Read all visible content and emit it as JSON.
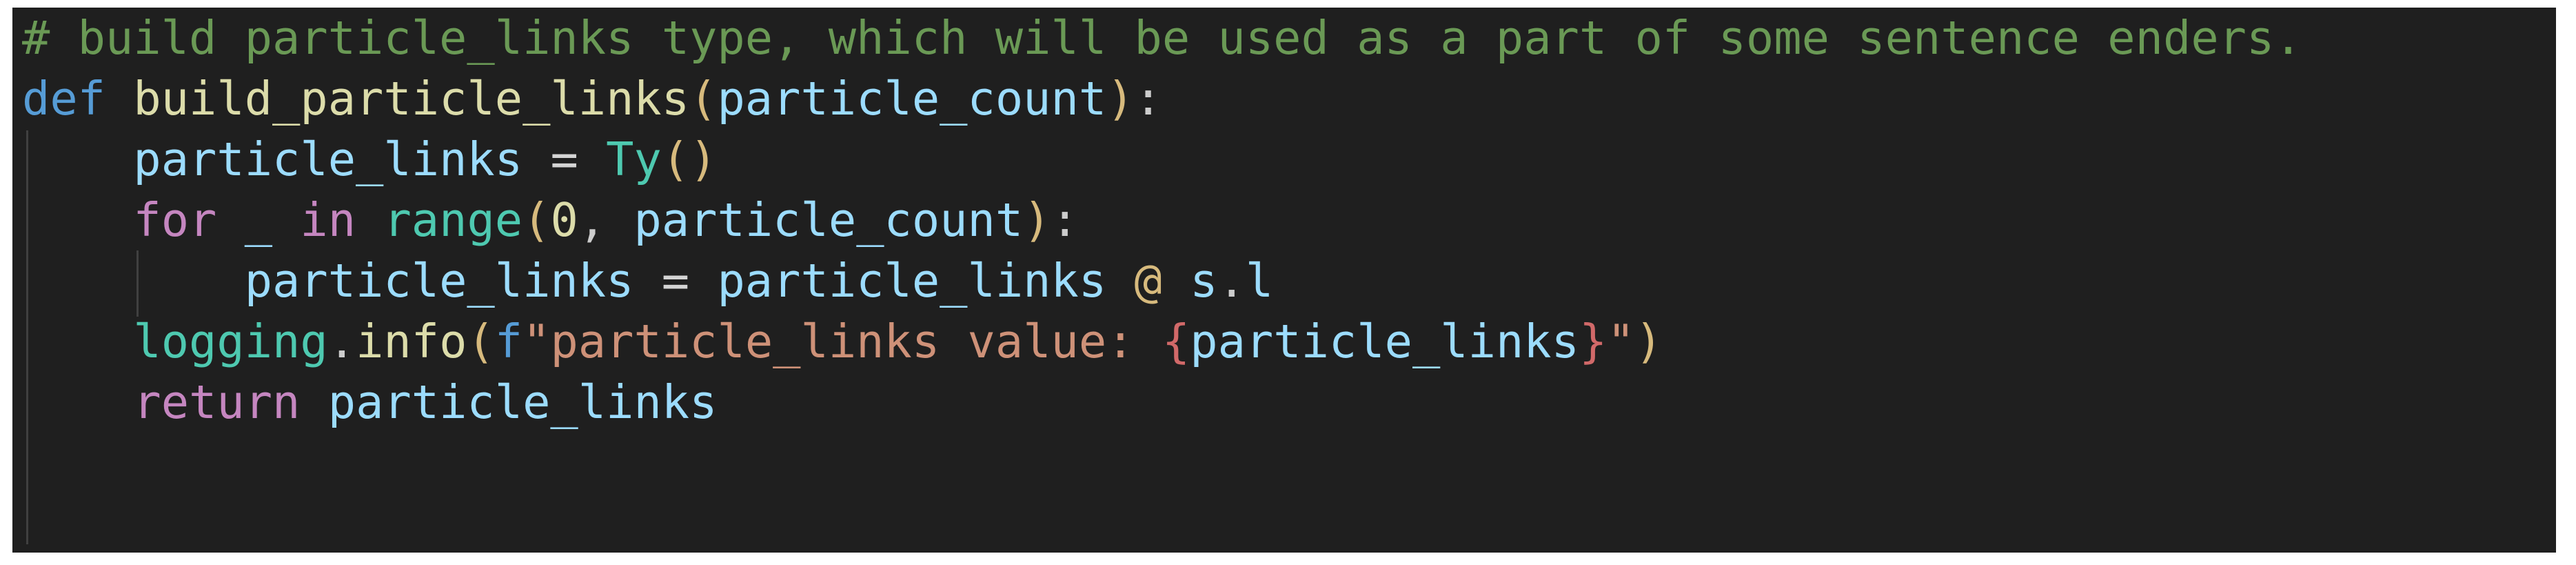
{
  "editor": {
    "background_color": "#1f1f1f",
    "page_background_color": "#ffffff",
    "language": "python",
    "indent_guide_color": "#404040",
    "palette": {
      "comment": "#6A9955",
      "keyword": "#569CD6",
      "control_keyword": "#C586C0",
      "function_name": "#DCDCAA",
      "class_name": "#4EC9B0",
      "builtin": "#4EC9B0",
      "variable": "#9CDCFE",
      "parameter": "#9CDCFE",
      "bracket_level_1": "#D7BA7D",
      "bracket_level_2": "#FFD700",
      "operator": "#D4D4D4",
      "number": "#DCDCAA",
      "string": "#CE9178",
      "fstring_brace": "#D16969"
    }
  },
  "code": {
    "plain_text": "# build particle_links type, which will be used as a part of some sentence enders.\ndef build_particle_links(particle_count):\n    particle_links = Ty()\n    for _ in range(0, particle_count):\n        particle_links = particle_links @ s.l\n    logging.info(f\"particle_links value: {particle_links}\")\n    return particle_links",
    "lines": [
      {
        "id": "line-comment",
        "indent": 0,
        "tokens": [
          {
            "text": "# build particle_links type, which will be used as a part of some sentence enders.",
            "kind": "comment"
          }
        ]
      },
      {
        "id": "line-def",
        "indent": 0,
        "tokens": [
          {
            "text": "def",
            "kind": "keyword"
          },
          {
            "text": " ",
            "kind": "plain"
          },
          {
            "text": "build_particle_links",
            "kind": "func"
          },
          {
            "text": "(",
            "kind": "paren"
          },
          {
            "text": "particle_count",
            "kind": "param"
          },
          {
            "text": ")",
            "kind": "paren"
          },
          {
            "text": ":",
            "kind": "punct"
          }
        ]
      },
      {
        "id": "line-assign-ty",
        "indent": 1,
        "tokens": [
          {
            "text": "    ",
            "kind": "plain"
          },
          {
            "text": "particle_links",
            "kind": "var"
          },
          {
            "text": " ",
            "kind": "plain"
          },
          {
            "text": "=",
            "kind": "op"
          },
          {
            "text": " ",
            "kind": "plain"
          },
          {
            "text": "Ty",
            "kind": "class"
          },
          {
            "text": "(",
            "kind": "paren"
          },
          {
            "text": ")",
            "kind": "paren"
          }
        ]
      },
      {
        "id": "line-for",
        "indent": 1,
        "tokens": [
          {
            "text": "    ",
            "kind": "plain"
          },
          {
            "text": "for",
            "kind": "control"
          },
          {
            "text": " ",
            "kind": "plain"
          },
          {
            "text": "_",
            "kind": "var"
          },
          {
            "text": " ",
            "kind": "plain"
          },
          {
            "text": "in",
            "kind": "control"
          },
          {
            "text": " ",
            "kind": "plain"
          },
          {
            "text": "range",
            "kind": "builtin"
          },
          {
            "text": "(",
            "kind": "paren"
          },
          {
            "text": "0",
            "kind": "num"
          },
          {
            "text": ",",
            "kind": "punct"
          },
          {
            "text": " ",
            "kind": "plain"
          },
          {
            "text": "particle_count",
            "kind": "var"
          },
          {
            "text": ")",
            "kind": "paren"
          },
          {
            "text": ":",
            "kind": "punct"
          }
        ]
      },
      {
        "id": "line-matmul",
        "indent": 2,
        "tokens": [
          {
            "text": "        ",
            "kind": "plain"
          },
          {
            "text": "particle_links",
            "kind": "var"
          },
          {
            "text": " ",
            "kind": "plain"
          },
          {
            "text": "=",
            "kind": "op"
          },
          {
            "text": " ",
            "kind": "plain"
          },
          {
            "text": "particle_links",
            "kind": "var"
          },
          {
            "text": " ",
            "kind": "plain"
          },
          {
            "text": "@",
            "kind": "at"
          },
          {
            "text": " ",
            "kind": "plain"
          },
          {
            "text": "s",
            "kind": "var"
          },
          {
            "text": ".",
            "kind": "punct"
          },
          {
            "text": "l",
            "kind": "var"
          }
        ]
      },
      {
        "id": "line-logging",
        "indent": 1,
        "tokens": [
          {
            "text": "    ",
            "kind": "plain"
          },
          {
            "text": "logging",
            "kind": "class"
          },
          {
            "text": ".",
            "kind": "punct"
          },
          {
            "text": "info",
            "kind": "func"
          },
          {
            "text": "(",
            "kind": "paren"
          },
          {
            "text": "f",
            "kind": "keyword"
          },
          {
            "text": "\"",
            "kind": "string"
          },
          {
            "text": "particle_links value: ",
            "kind": "string"
          },
          {
            "text": "{",
            "kind": "fbrace"
          },
          {
            "text": "particle_links",
            "kind": "var"
          },
          {
            "text": "}",
            "kind": "fbrace"
          },
          {
            "text": "\"",
            "kind": "string"
          },
          {
            "text": ")",
            "kind": "paren"
          }
        ]
      },
      {
        "id": "line-return",
        "indent": 1,
        "tokens": [
          {
            "text": "    ",
            "kind": "plain"
          },
          {
            "text": "return",
            "kind": "control"
          },
          {
            "text": " ",
            "kind": "plain"
          },
          {
            "text": "particle_links",
            "kind": "var"
          }
        ]
      }
    ]
  }
}
